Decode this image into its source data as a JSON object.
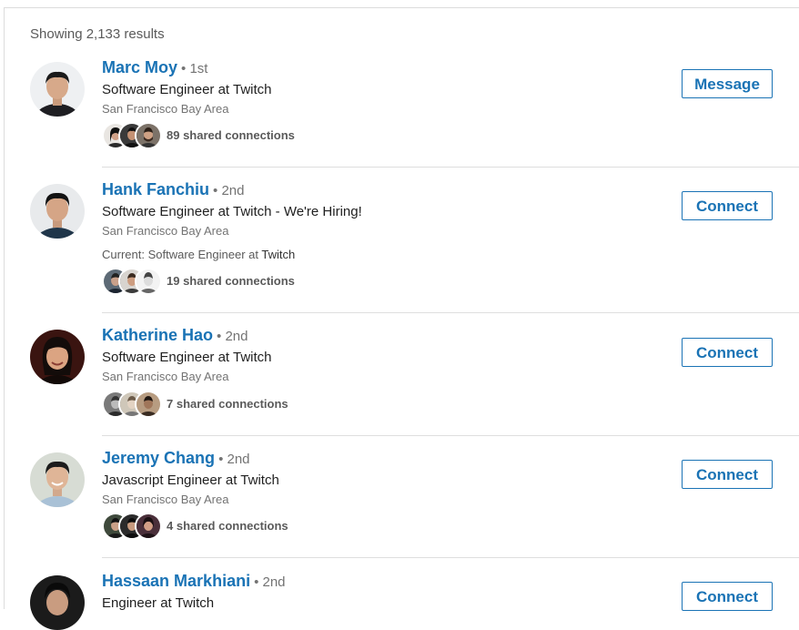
{
  "results_count": "Showing 2,133 results",
  "results": [
    {
      "name": "Marc Moy",
      "degree": "• 1st",
      "headline": "Software Engineer at Twitch",
      "location": "San Francisco Bay Area",
      "current_prefix": "",
      "current_company": "",
      "shared": "89 shared connections",
      "action": "Message"
    },
    {
      "name": "Hank Fanchiu",
      "degree": "• 2nd",
      "headline": "Software Engineer at Twitch - We're Hiring!",
      "location": "San Francisco Bay Area",
      "current_prefix": "Current: Software Engineer at ",
      "current_company": "Twitch",
      "shared": "19 shared connections",
      "action": "Connect"
    },
    {
      "name": "Katherine Hao",
      "degree": "• 2nd",
      "headline": "Software Engineer at Twitch",
      "location": "San Francisco Bay Area",
      "current_prefix": "",
      "current_company": "",
      "shared": "7 shared connections",
      "action": "Connect"
    },
    {
      "name": "Jeremy Chang",
      "degree": "• 2nd",
      "headline": "Javascript Engineer at Twitch",
      "location": "San Francisco Bay Area",
      "current_prefix": "",
      "current_company": "",
      "shared": "4 shared connections",
      "action": "Connect"
    },
    {
      "name": "Hassaan Markhiani",
      "degree": "• 2nd",
      "headline": "Engineer at Twitch",
      "location": "",
      "current_prefix": "",
      "current_company": "",
      "shared": "",
      "action": "Connect"
    }
  ],
  "colors": {
    "link": "#1a73b5",
    "muted": "#737373",
    "divider": "#dedede"
  }
}
